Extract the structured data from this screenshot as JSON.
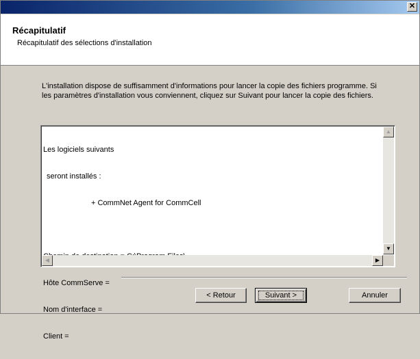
{
  "window": {
    "close_glyph": "✕"
  },
  "header": {
    "title": "Récapitulatif",
    "subtitle": "Récapitulatif des sélections d'installation"
  },
  "intro": {
    "text": "L'installation dispose de suffisamment d'informations pour lancer la copie des fichiers programme. Si les paramètres d'installation vous conviennent, cliquez sur Suivant pour lancer la copie des fichiers."
  },
  "summary": {
    "lines": [
      "Les logiciels suivants",
      " seront installés :",
      "+ CommNet Agent for CommCell",
      "",
      "Chemin de destination = C:\\Program Files\\",
      "Hôte CommServe =",
      "Nom d'interface =",
      "Client ="
    ]
  },
  "scrollbars": {
    "up": "▲",
    "down": "▼",
    "left": "◀",
    "right": "▶"
  },
  "buttons": {
    "back": "< Retour",
    "next": "Suivant >",
    "cancel": "Annuler"
  }
}
